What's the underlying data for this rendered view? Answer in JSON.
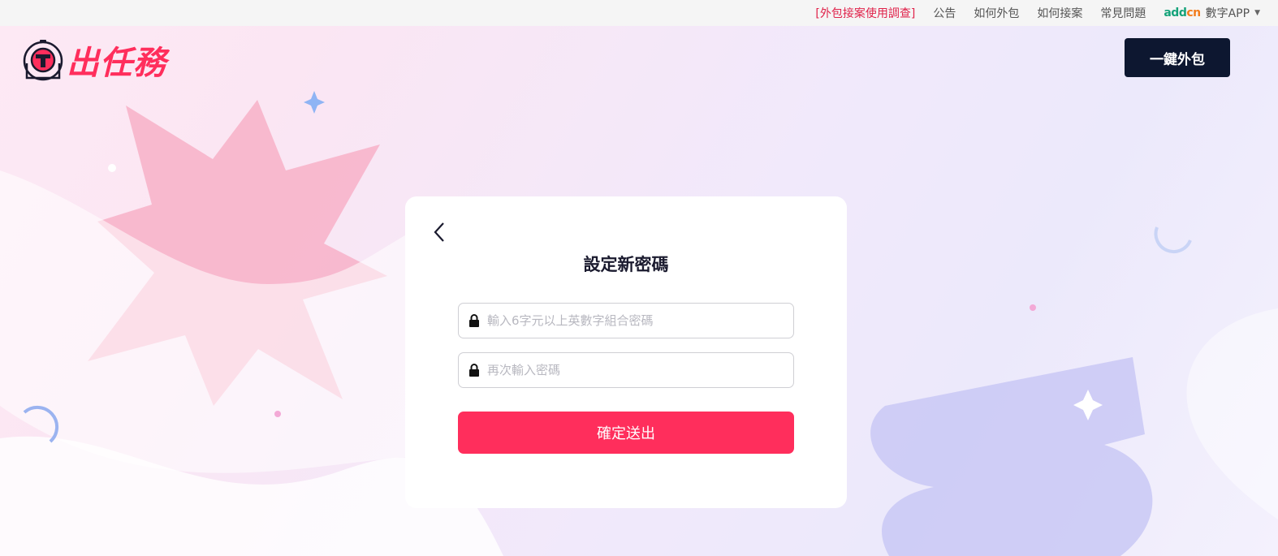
{
  "topbar": {
    "links": [
      {
        "label": "[外包接案使用調查]"
      },
      {
        "label": "公告"
      },
      {
        "label": "如何外包"
      },
      {
        "label": "如何接案"
      },
      {
        "label": "常見問題"
      }
    ],
    "addcn": {
      "brand_a": "add",
      "brand_b": "cn",
      "label": "數字APP"
    }
  },
  "header": {
    "logo_text": "出任務",
    "cta_label": "一鍵外包"
  },
  "form": {
    "title": "設定新密碼",
    "password_placeholder": "輸入6字元以上英數字組合密碼",
    "confirm_placeholder": "再次輸入密碼",
    "submit_label": "確定送出"
  },
  "colors": {
    "accent": "#ff2e5c",
    "dark": "#0d1730",
    "survey_link": "#e0224a",
    "addcn_green": "#15a37a",
    "addcn_orange": "#f27c1c"
  },
  "icons": [
    "logo-astronaut-icon",
    "back-chevron-icon",
    "lock-icon",
    "caret-down-icon"
  ]
}
